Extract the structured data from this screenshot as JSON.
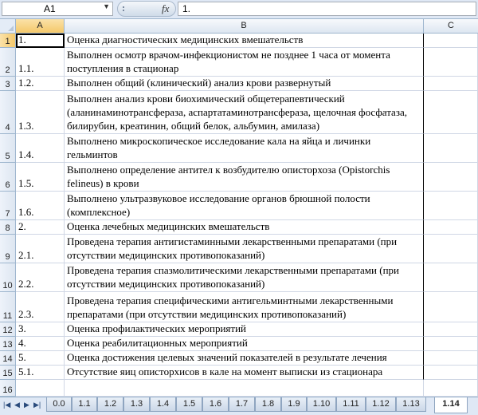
{
  "formula_bar": {
    "name_box": "A1",
    "fx_label": "fx",
    "formula_value": "1."
  },
  "columns": [
    "A",
    "B",
    "C"
  ],
  "rows": [
    {
      "num": "1",
      "a": "1.",
      "b": "Оценка диагностических медицинских вмешательств"
    },
    {
      "num": "2",
      "a": "1.1.",
      "b": "Выполнен осмотр врачом-инфекционистом не позднее 1 часа от момента поступления в стационар"
    },
    {
      "num": "3",
      "a": "1.2.",
      "b": "Выполнен общий (клинический) анализ крови развернутый"
    },
    {
      "num": "4",
      "a": "1.3.",
      "b": "Выполнен анализ крови биохимический общетерапевтический (аланинаминотрансфераза, аспартатаминотрансфераза, щелочная фосфатаза, билирубин, креатинин, общий белок, альбумин, амилаза)"
    },
    {
      "num": "5",
      "a": "1.4.",
      "b": "Выполнено микроскопическое исследование кала на яйца и личинки гельминтов"
    },
    {
      "num": "6",
      "a": "1.5.",
      "b": "Выполнено определение антител к возбудителю описторхоза (Opistorchis felineus) в крови"
    },
    {
      "num": "7",
      "a": "1.6.",
      "b": "Выполнено ультразвуковое исследование органов брюшной полости (комплексное)"
    },
    {
      "num": "8",
      "a": "2.",
      "b": "Оценка лечебных медицинских вмешательств"
    },
    {
      "num": "9",
      "a": "2.1.",
      "b": "Проведена терапия антигистаминными лекарственными препаратами (при отсутствии медицинских противопоказаний)"
    },
    {
      "num": "10",
      "a": "2.2.",
      "b": "Проведена терапия спазмолитическими лекарственными препаратами (при отсутствии медицинских противопоказаний)"
    },
    {
      "num": "11",
      "a": "2.3.",
      "b": "Проведена терапия специфическими антигельминтными лекарственными препаратами (при отсутствии медицинских противопоказаний)"
    },
    {
      "num": "12",
      "a": "3.",
      "b": "Оценка профилактических мероприятий"
    },
    {
      "num": "13",
      "a": "4.",
      "b": "Оценка реабилитационных мероприятий"
    },
    {
      "num": "14",
      "a": "5.",
      "b": "Оценка достижения целевых значений показателей в результате лечения"
    },
    {
      "num": "15",
      "a": "5.1.",
      "b": "Отсутствие яиц описторхисов в кале на момент выписки из стационара"
    },
    {
      "num": "16",
      "a": "",
      "b": ""
    }
  ],
  "sheet_tabs": [
    "0.0",
    "1.1",
    "1.2",
    "1.3",
    "1.4",
    "1.5",
    "1.6",
    "1.7",
    "1.8",
    "1.9",
    "1.10",
    "1.11",
    "1.12",
    "1.13",
    "1.14"
  ],
  "active_tab": "1.14"
}
